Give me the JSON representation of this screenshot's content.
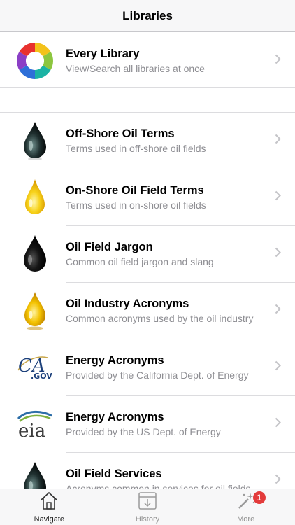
{
  "navbar": {
    "title": "Libraries"
  },
  "rows": [
    {
      "title": "Every Library",
      "subtitle": "View/Search all libraries at once",
      "icon": "color-wheel-icon"
    },
    {
      "title": "Off-Shore Oil Terms",
      "subtitle": "Terms used in off-shore oil fields",
      "icon": "dark-oil-drop-icon"
    },
    {
      "title": "On-Shore Oil Field Terms",
      "subtitle": "Terms used in on-shore oil fields",
      "icon": "yellow-oil-drop-icon"
    },
    {
      "title": "Oil Field Jargon",
      "subtitle": "Common oil field jargon and slang",
      "icon": "black-oil-drop-icon"
    },
    {
      "title": "Oil Industry Acronyms",
      "subtitle": "Common acronyms used by the oil industry",
      "icon": "golden-oil-drop-icon"
    },
    {
      "title": "Energy Acronyms",
      "subtitle": "Provided by the California Dept. of Energy",
      "icon": "ca-gov-logo-icon",
      "logo_text": "CA",
      "logo_sub": ".GOV"
    },
    {
      "title": "Energy Acronyms",
      "subtitle": "Provided by the US Dept. of Energy",
      "icon": "eia-logo-icon",
      "logo_text": "eia"
    },
    {
      "title": "Oil Field Services",
      "subtitle": "Acronyms common in services for oil fields",
      "icon": "dark-oil-drop-icon"
    }
  ],
  "tabbar": {
    "tabs": [
      {
        "label": "Navigate",
        "icon": "house-icon",
        "active": true
      },
      {
        "label": "History",
        "icon": "download-box-icon",
        "active": false
      },
      {
        "label": "More",
        "icon": "magic-wand-icon",
        "active": false,
        "badge": "1"
      }
    ]
  },
  "colors": {
    "accent": "#e33b3b",
    "separator": "#dcdcdf",
    "subtitle": "#8e8e93"
  }
}
